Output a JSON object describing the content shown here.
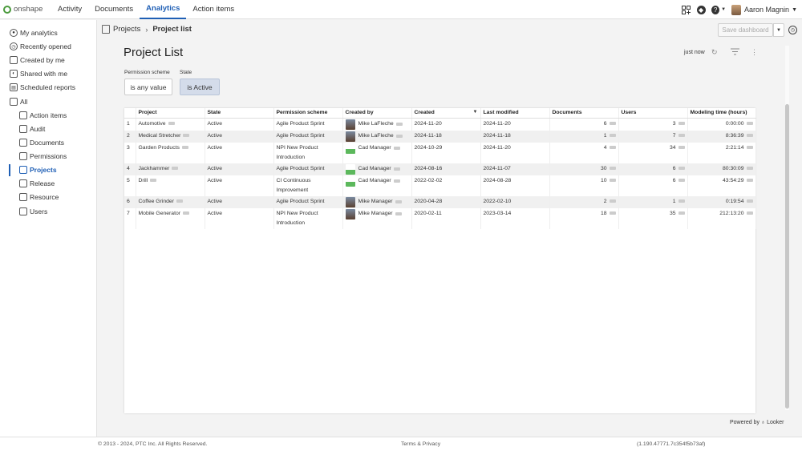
{
  "topnav": {
    "logo_text": "onshape",
    "links": [
      {
        "label": "Activity",
        "active": false
      },
      {
        "label": "Documents",
        "active": false
      },
      {
        "label": "Analytics",
        "active": true
      },
      {
        "label": "Action items",
        "active": false
      }
    ],
    "user_name": "Aaron Magnin",
    "icons": [
      "apps-add-icon",
      "learning-icon",
      "help-icon",
      "user-avatar"
    ],
    "accent_color": "#1f5fb5"
  },
  "sidebar": {
    "items": [
      {
        "label": "My analytics",
        "icon": "user-circle-icon"
      },
      {
        "label": "Recently opened",
        "icon": "clock-icon"
      },
      {
        "label": "Created by me",
        "icon": "document-icon"
      },
      {
        "label": "Shared with me",
        "icon": "shared-icon"
      },
      {
        "label": "Scheduled reports",
        "icon": "schedule-icon"
      },
      {
        "label": "All",
        "icon": "folder-icon"
      }
    ],
    "sub_items": [
      {
        "label": "Action items",
        "active": false
      },
      {
        "label": "Audit",
        "active": false
      },
      {
        "label": "Documents",
        "active": false
      },
      {
        "label": "Permissions",
        "active": false
      },
      {
        "label": "Projects",
        "active": true
      },
      {
        "label": "Release",
        "active": false
      },
      {
        "label": "Resource",
        "active": false
      },
      {
        "label": "Users",
        "active": false
      }
    ]
  },
  "breadcrumb": {
    "parent": "Projects",
    "current": "Project list"
  },
  "toolbar": {
    "save_label": "Save dashboard"
  },
  "dashboard": {
    "title": "Project List",
    "refreshed": "just now",
    "filters": [
      {
        "label": "Permission scheme",
        "value": "is any value"
      },
      {
        "label": "State",
        "value": "is Active"
      }
    ]
  },
  "table": {
    "columns": [
      "Project",
      "State",
      "Permission scheme",
      "Created by",
      "Created",
      "Last modified",
      "Documents",
      "Users",
      "Modeling time (hours)"
    ],
    "rows": [
      {
        "n": "1",
        "project": "Automotive",
        "state": "Active",
        "scheme": [
          "Agile Product Sprint"
        ],
        "created_by": "Mike LaFleche",
        "avatar": "photo",
        "created": "2024-11-20",
        "modified": "2024-11-20",
        "documents": "6",
        "users": "3",
        "time": "0:00:00"
      },
      {
        "n": "2",
        "project": "Medical Stretcher",
        "state": "Active",
        "scheme": [
          "Agile Product Sprint"
        ],
        "created_by": "Mike LaFleche",
        "avatar": "photo",
        "created": "2024-11-18",
        "modified": "2024-11-18",
        "documents": "1",
        "users": "7",
        "time": "8:36:39"
      },
      {
        "n": "3",
        "project": "Garden Products",
        "state": "Active",
        "scheme": [
          "NPI New Product",
          "Introduction"
        ],
        "created_by": "Cad Manager",
        "avatar": "green",
        "created": "2024-10-29",
        "modified": "2024-11-20",
        "documents": "4",
        "users": "34",
        "time": "2:21:14"
      },
      {
        "n": "4",
        "project": "Jackhammer",
        "state": "Active",
        "scheme": [
          "Agile Product Sprint"
        ],
        "created_by": "Cad Manager",
        "avatar": "green",
        "created": "2024-08-16",
        "modified": "2024-11-07",
        "documents": "30",
        "users": "6",
        "time": "80:30:09"
      },
      {
        "n": "5",
        "project": "Drill",
        "state": "Active",
        "scheme": [
          "CI Continuous",
          "Improvement"
        ],
        "created_by": "Cad Manager",
        "avatar": "green",
        "created": "2022-02-02",
        "modified": "2024-08-28",
        "documents": "10",
        "users": "6",
        "time": "43:54:29"
      },
      {
        "n": "6",
        "project": "Coffee Grinder",
        "state": "Active",
        "scheme": [
          "Agile Product Sprint"
        ],
        "created_by": "Mike Manager",
        "avatar": "photo",
        "created": "2020-04-28",
        "modified": "2022-02-10",
        "documents": "2",
        "users": "1",
        "time": "0:19:54"
      },
      {
        "n": "7",
        "project": "Mobile Generator",
        "state": "Active",
        "scheme": [
          "NPI New Product",
          "Introduction"
        ],
        "created_by": "Mike Manager",
        "avatar": "photo",
        "created": "2020-02-11",
        "modified": "2023-03-14",
        "documents": "18",
        "users": "35",
        "time": "212:13:20"
      }
    ]
  },
  "powered_by": "Powered by ♁ Looker",
  "footer": {
    "copyright": "© 2013 - 2024, PTC Inc. All Rights Reserved.",
    "terms": "Terms & Privacy",
    "version": "(1.190.47771.7c354f5b73af)"
  }
}
